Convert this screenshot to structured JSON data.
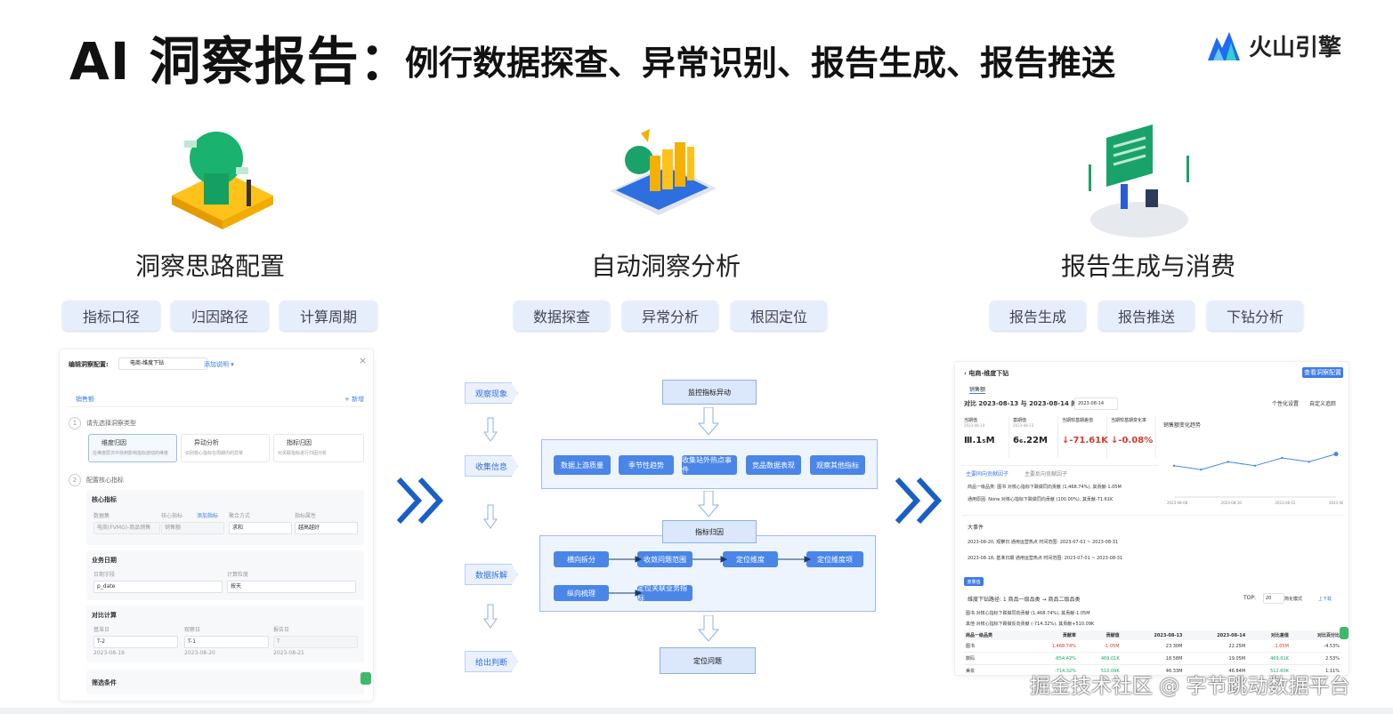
{
  "title": {
    "main": "AI 洞察报告：",
    "sub": "例行数据探查、异常识别、报告生成、报告推送"
  },
  "brand": {
    "name": "火山引擎",
    "color": "#1f6bf2"
  },
  "columns": [
    {
      "title": "洞察思路配置",
      "tags": [
        "指标口径",
        "归因路径",
        "计算周期"
      ]
    },
    {
      "title": "自动洞察分析",
      "tags": [
        "数据探查",
        "异常分析",
        "根因定位"
      ]
    },
    {
      "title": "报告生成与消费",
      "tags": [
        "报告生成",
        "报告推送",
        "下钻分析"
      ]
    }
  ],
  "config_panel": {
    "header_label": "编辑洞察配置:",
    "header_value": "电商-维度下钻",
    "add_desc": "添加说明 ▾",
    "close": "×",
    "tab": "销售额",
    "add_new": "+ 新增",
    "step1": "请先选择洞察类型",
    "types": [
      {
        "name": "维度归因",
        "desc": "在维度层次中找到影响指标波动的维度"
      },
      {
        "name": "异动分析",
        "desc": "识别核心指标在周期内的异常"
      },
      {
        "name": "指标归因",
        "desc": "对关联指标进行归因分析"
      }
    ],
    "step2": "配置核心指标",
    "core_metric": "核心指标",
    "core_cols": [
      "数据集",
      "核心指标",
      "添加指标",
      "聚合方式",
      "指标属性"
    ],
    "core_vals": [
      "电商(FVMG)-商品销售",
      "销售额",
      "求和",
      "越高越好"
    ],
    "biz_date": "业务日期",
    "date_cols": [
      "日期字段",
      "计算粒度"
    ],
    "date_vals": [
      "p_date",
      "按天"
    ],
    "compare": "对比计算",
    "cmp_cols": [
      "基准日",
      "观察日",
      "报告日"
    ],
    "cmp_vals": [
      "T-2",
      "T-1",
      "T"
    ],
    "cmp_dates": [
      "2023-08-19",
      "2023-08-20",
      "2023-08-21"
    ],
    "filter": "筛选条件"
  },
  "flow": {
    "side_tags": [
      "观察现象",
      "收集信息",
      "数据拆解",
      "给出判断"
    ],
    "monitor": "监控指标异动",
    "info_boxes": [
      "数据上游质量",
      "季节性趋势",
      "收集站外热点事件",
      "竞品数据表现",
      "观察其他指标"
    ],
    "attribution": "指标归因",
    "attr_boxes": [
      "横向拆分",
      "收敛问题范围",
      "定位维度",
      "定位维度项",
      "纵向梳理",
      "定位关联业务指标"
    ],
    "locate": "定位问题"
  },
  "report": {
    "breadcrumb": "电商-维度下钻",
    "config_btn": "查看洞察配置",
    "tab": "销售额",
    "compare_text": "对比 2023-08-13 与 2023-08-14 的 销售额",
    "date_pick": "2023-08-14",
    "personal": "个性化设置",
    "custom": "自定义追踪",
    "metrics": [
      {
        "label": "当期值",
        "sub": "2023-08-14",
        "value": "Ⅲ.1₅M",
        "color": "#222"
      },
      {
        "label": "基期值",
        "sub": "2023-08-13",
        "value": "6₆.22M",
        "color": "#222"
      },
      {
        "label": "当期较基期差值",
        "sub": "",
        "value": "↓-71.61K",
        "color": "#d93a2b"
      },
      {
        "label": "当期较基期变化率",
        "sub": "",
        "value": "↓-0.08%",
        "color": "#d93a2b"
      }
    ],
    "trend_title": "销售额变化趋势",
    "trend": {
      "type": "line",
      "x": [
        "2023-08-08",
        "2023-08-10",
        "2023-08-12",
        "2023-08-14"
      ],
      "values": [
        88,
        87,
        89,
        88,
        90,
        89,
        91
      ]
    },
    "factor_tabs": [
      "主要同向贡献因子",
      "主要反向贡献因子"
    ],
    "factor_lines": [
      "商品一级品类: 图书   对核心指标下跌做同向贡献 (1,468.74%), 其贡献-1.05M",
      "通用原因: None   对核心指标下跌做同向贡献 (100.00%), 其贡献-71.61K"
    ],
    "events_title": "大事件",
    "events": [
      "2023-08-20, 观察日   通用运营热点   时间范围: 2023-07-01 ~ 2023-08-31",
      "2023-08-18, 基准日期   通用运营热点   时间范围: 2023-07-01 ~ 2023-08-31"
    ],
    "drill_btn": "度量值",
    "drill_path": "维度下钻路径: 1   商品一级品类 → 商品二级品类",
    "top_label": "TOP:",
    "top_val": "20",
    "mode": "简化模式",
    "export": "上下载",
    "drill_note1": "图书 对核心指标下跌做同向贡献 (1,468.74%), 其贡献-1.05M",
    "drill_note2": "其他 对核心指标下跌做反向贡献 (-714.32%), 其贡献+510.09K",
    "table_headers": [
      "商品一级品类",
      "贡献率",
      "贡献值",
      "2023-08-13",
      "2023-08-14",
      "对比差值",
      "对比百分比"
    ],
    "table_rows": [
      [
        "图书",
        "1,468.74%",
        "-1.05M",
        "23.30M",
        "22.25M",
        "-1.05M",
        "-4.53%"
      ],
      [
        "数码",
        "-654.42%",
        "469.01K",
        "18.58M",
        "19.05M",
        "469.01K",
        "2.53%"
      ],
      [
        "美妆",
        "-714.32%",
        "510.09K",
        "46.33M",
        "46.84M",
        "512.60K",
        "1.11%"
      ]
    ]
  },
  "watermark": "掘金技术社区 @ 字节跳动数据平台"
}
